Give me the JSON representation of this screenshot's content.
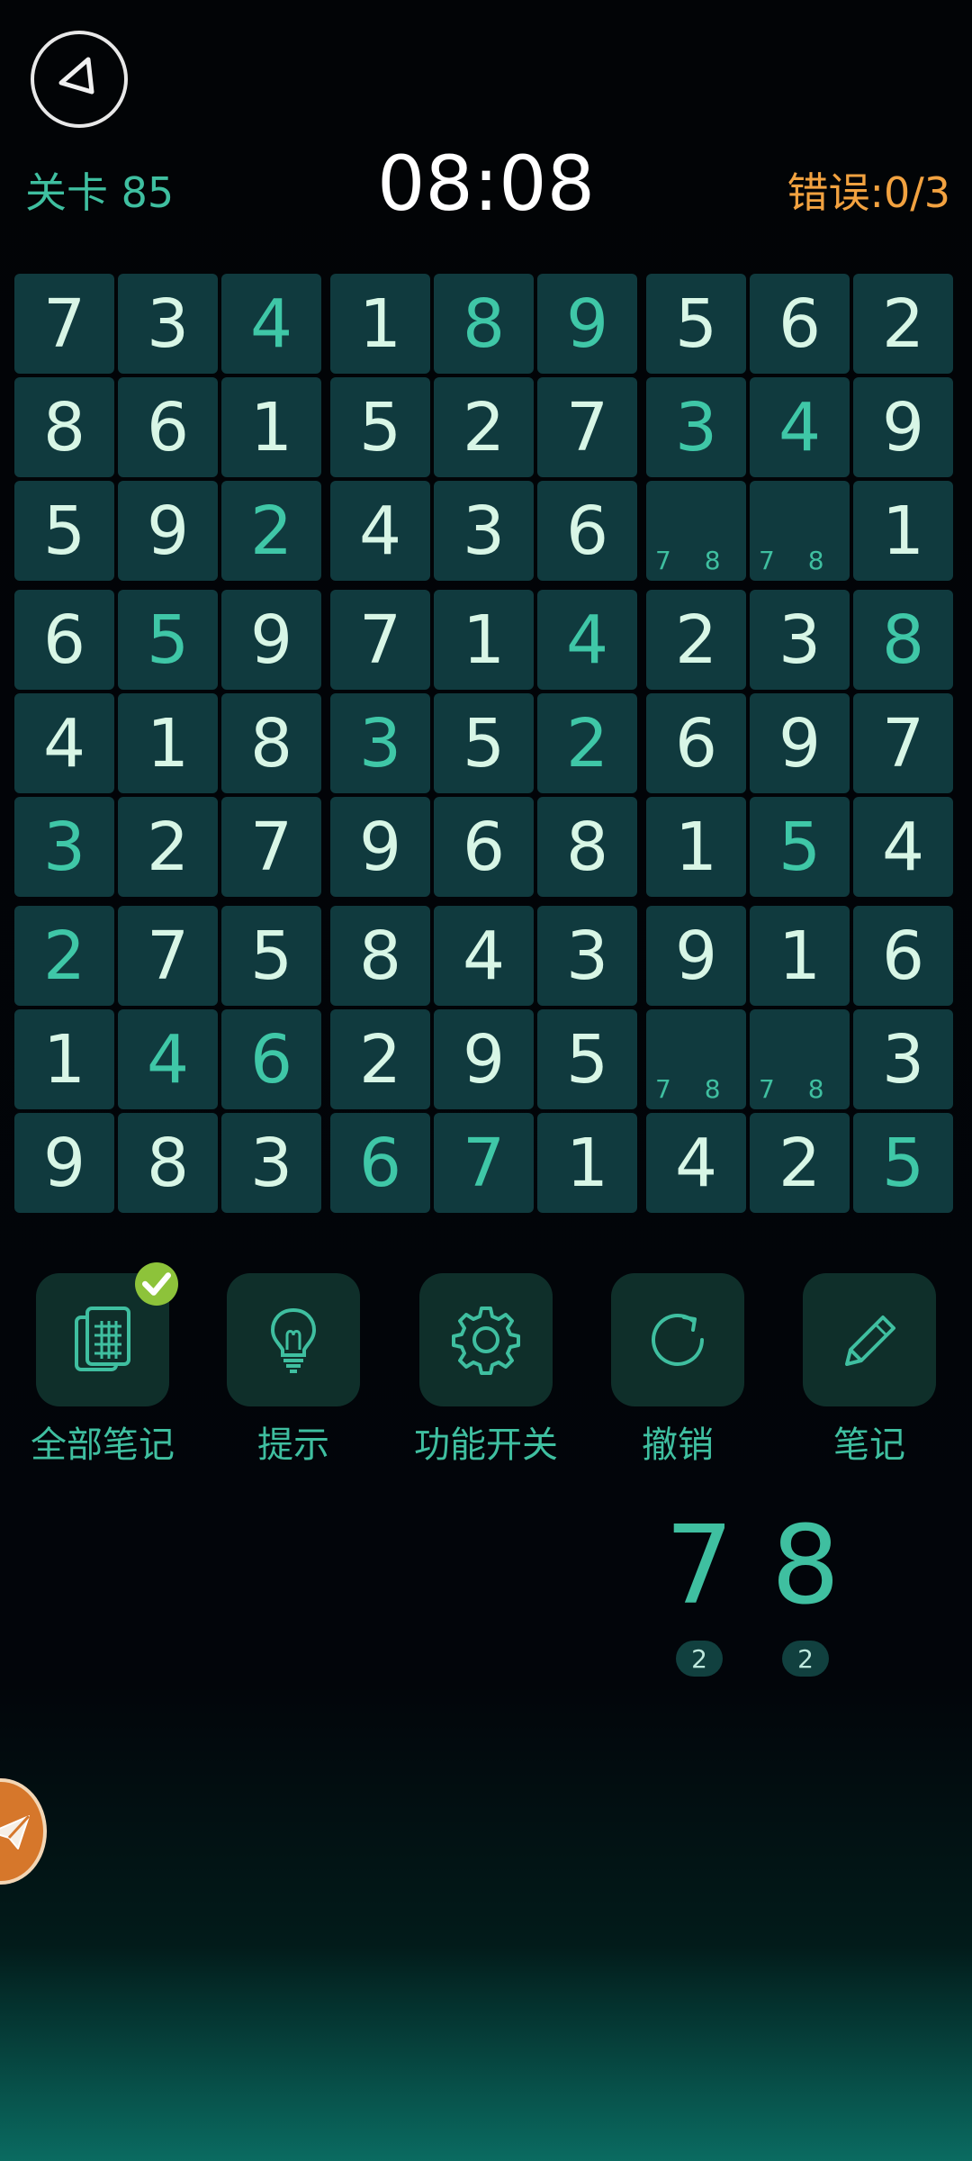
{
  "header": {
    "level_label": "关卡 85",
    "timer": "08:08",
    "errors_label": "错误:0/3"
  },
  "board": {
    "rows": [
      [
        "7",
        "3",
        "4",
        "1",
        "8",
        "9",
        "5",
        "6",
        "2"
      ],
      [
        "8",
        "6",
        "1",
        "5",
        "2",
        "7",
        "3",
        "4",
        "9"
      ],
      [
        "5",
        "9",
        "2",
        "4",
        "3",
        "6",
        "",
        "",
        "1"
      ],
      [
        "6",
        "5",
        "9",
        "7",
        "1",
        "4",
        "2",
        "3",
        "8"
      ],
      [
        "4",
        "1",
        "8",
        "3",
        "5",
        "2",
        "6",
        "9",
        "7"
      ],
      [
        "3",
        "2",
        "7",
        "9",
        "6",
        "8",
        "1",
        "5",
        "4"
      ],
      [
        "2",
        "7",
        "5",
        "8",
        "4",
        "3",
        "9",
        "1",
        "6"
      ],
      [
        "1",
        "4",
        "6",
        "2",
        "9",
        "5",
        "",
        "",
        "3"
      ],
      [
        "9",
        "8",
        "3",
        "6",
        "7",
        "1",
        "4",
        "2",
        "5"
      ]
    ],
    "user_entered": [
      [
        0,
        2
      ],
      [
        0,
        4
      ],
      [
        0,
        5
      ],
      [
        1,
        6
      ],
      [
        1,
        7
      ],
      [
        2,
        2
      ],
      [
        3,
        1
      ],
      [
        3,
        5
      ],
      [
        3,
        8
      ],
      [
        4,
        3
      ],
      [
        4,
        5
      ],
      [
        5,
        0
      ],
      [
        5,
        7
      ],
      [
        6,
        0
      ],
      [
        7,
        1
      ],
      [
        7,
        2
      ],
      [
        8,
        3
      ],
      [
        8,
        4
      ],
      [
        8,
        8
      ]
    ],
    "notes": [
      {
        "row": 2,
        "col": 6,
        "text": "7 8"
      },
      {
        "row": 2,
        "col": 7,
        "text": "7 8"
      },
      {
        "row": 7,
        "col": 6,
        "text": "7 8"
      },
      {
        "row": 7,
        "col": 7,
        "text": "7 8"
      }
    ]
  },
  "toolbar": {
    "items": [
      {
        "label": "全部笔记",
        "icon": "all-notes-icon"
      },
      {
        "label": "提示",
        "icon": "lightbulb-icon"
      },
      {
        "label": "功能开关",
        "icon": "gear-icon"
      },
      {
        "label": "撤销",
        "icon": "undo-icon"
      },
      {
        "label": "笔记",
        "icon": "pencil-icon"
      }
    ]
  },
  "numpad": {
    "keys": [
      {
        "digit": "7",
        "remaining": "2"
      },
      {
        "digit": "8",
        "remaining": "2"
      }
    ]
  },
  "colors": {
    "cell_bg": "#103a3e",
    "given_digit": "#d8f6e6",
    "user_digit": "#3fc7a7",
    "accent_teal": "#3fbfa0",
    "errors_orange": "#f2a240",
    "badge_green": "#8dc33a"
  }
}
